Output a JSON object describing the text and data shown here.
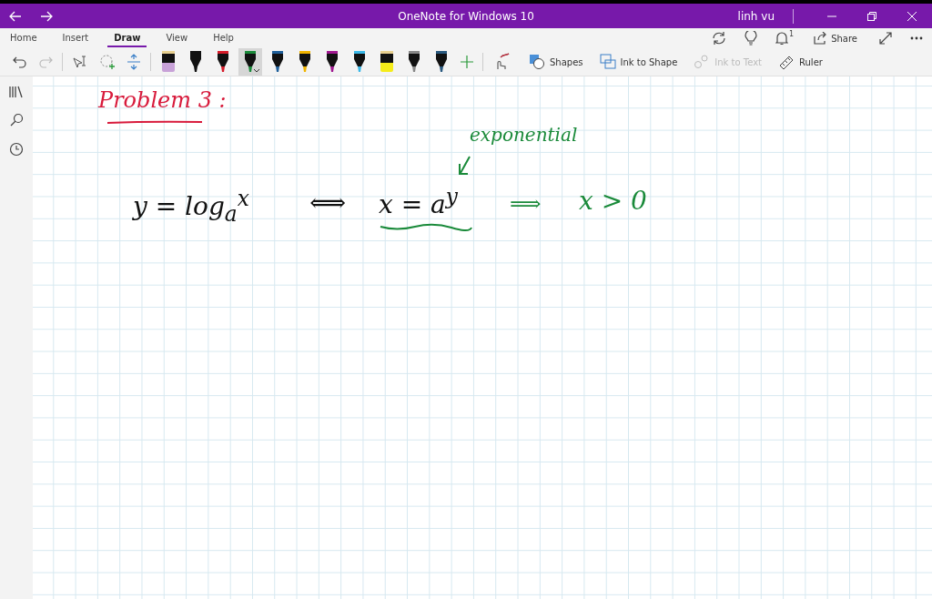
{
  "window": {
    "title": "OneNote for Windows 10",
    "user": "linh vu"
  },
  "tabs": [
    {
      "label": "Home",
      "selected": false
    },
    {
      "label": "Insert",
      "selected": false
    },
    {
      "label": "Draw",
      "selected": true
    },
    {
      "label": "View",
      "selected": false
    },
    {
      "label": "Help",
      "selected": false
    }
  ],
  "top_actions": {
    "notification_count": "1",
    "share": "Share"
  },
  "pens": [
    {
      "kind": "highlighter",
      "color": "#c8a2d8",
      "selected": false
    },
    {
      "kind": "pen",
      "color": "#111111",
      "selected": false
    },
    {
      "kind": "pen",
      "color": "#d61c2a",
      "selected": false
    },
    {
      "kind": "pen",
      "color": "#1a8a3a",
      "selected": true
    },
    {
      "kind": "pen",
      "color": "#1f5f9a",
      "selected": false
    },
    {
      "kind": "pen",
      "color": "#f0b400",
      "selected": false
    },
    {
      "kind": "pen",
      "color": "#a01890",
      "selected": false
    },
    {
      "kind": "pen",
      "color": "#3ab8e8",
      "selected": false
    },
    {
      "kind": "highlighter",
      "color": "#f5ec1a",
      "selected": false
    },
    {
      "kind": "pen",
      "color": "#888888",
      "selected": false
    },
    {
      "kind": "pen",
      "color": "#2a5a80",
      "selected": false
    }
  ],
  "tools": [
    {
      "label": "Shapes",
      "disabled": false
    },
    {
      "label": "Ink to Shape",
      "disabled": false
    },
    {
      "label": "Ink to Text",
      "disabled": true
    },
    {
      "label": "Ruler",
      "disabled": false
    }
  ],
  "ink": [
    {
      "text": "Problem 3 :",
      "color": "#d81b3c"
    },
    {
      "text": "y = log$_{a}$$^{x}$",
      "color": "#111111"
    },
    {
      "text": "⟺",
      "color": "#111111"
    },
    {
      "text": "x = a$^{y}$",
      "color": "#111111"
    },
    {
      "text": "exponential",
      "color": "#1a8a3a"
    },
    {
      "text": "⟹",
      "color": "#1a8a3a"
    },
    {
      "text": "x > 0",
      "color": "#1a8a3a"
    }
  ]
}
